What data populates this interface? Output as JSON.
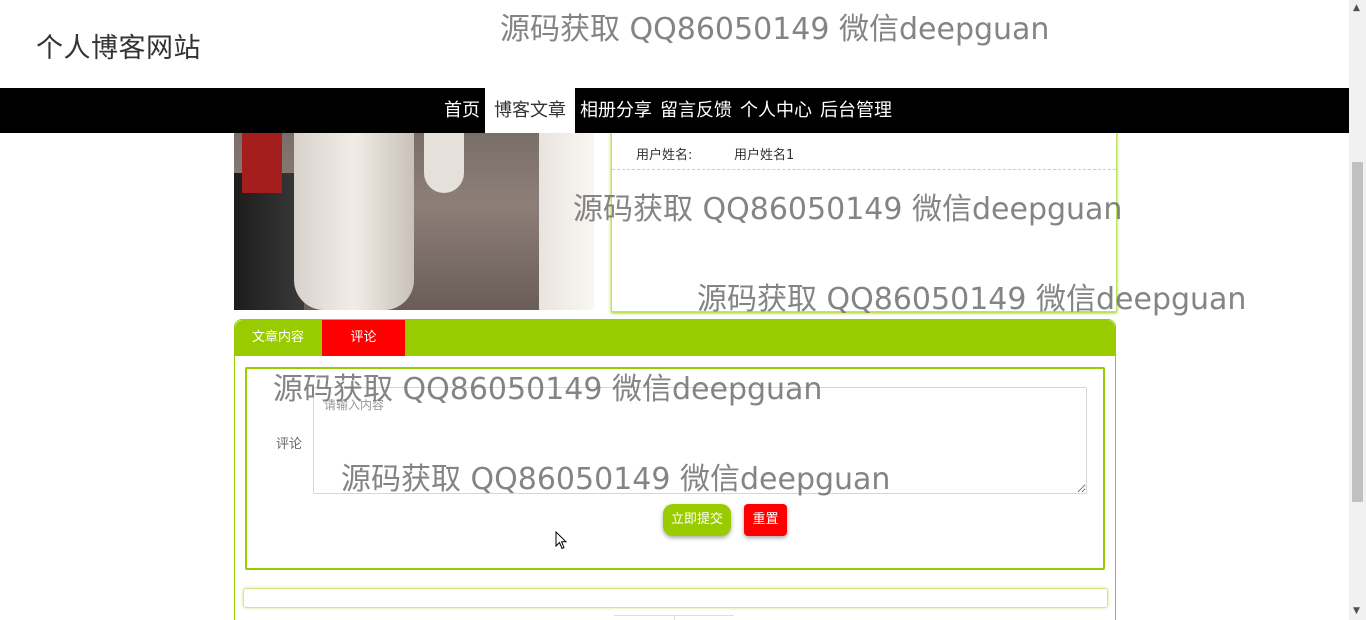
{
  "header": {
    "site_title": "个人博客网站"
  },
  "nav": {
    "items": [
      {
        "label": "首页",
        "active": false
      },
      {
        "label": "博客文章",
        "active": true
      },
      {
        "label": "相册分享",
        "active": false
      },
      {
        "label": "留言反馈",
        "active": false
      },
      {
        "label": "个人中心",
        "active": false
      },
      {
        "label": "后台管理",
        "active": false
      }
    ]
  },
  "article_info": {
    "user_label": "用户姓名:",
    "user_value": "用户姓名1"
  },
  "tabs": {
    "article": "文章内容",
    "comment": "评论",
    "active": "comment"
  },
  "comment_form": {
    "label": "评论",
    "placeholder": "请输入内容",
    "value": "",
    "submit_label": "立即提交",
    "reset_label": "重置"
  },
  "watermark": {
    "text": "源码获取 QQ86050149 微信deepguan"
  },
  "colors": {
    "accent": "#99cc00",
    "danger": "#ff0000",
    "nav_bg": "#000000"
  }
}
